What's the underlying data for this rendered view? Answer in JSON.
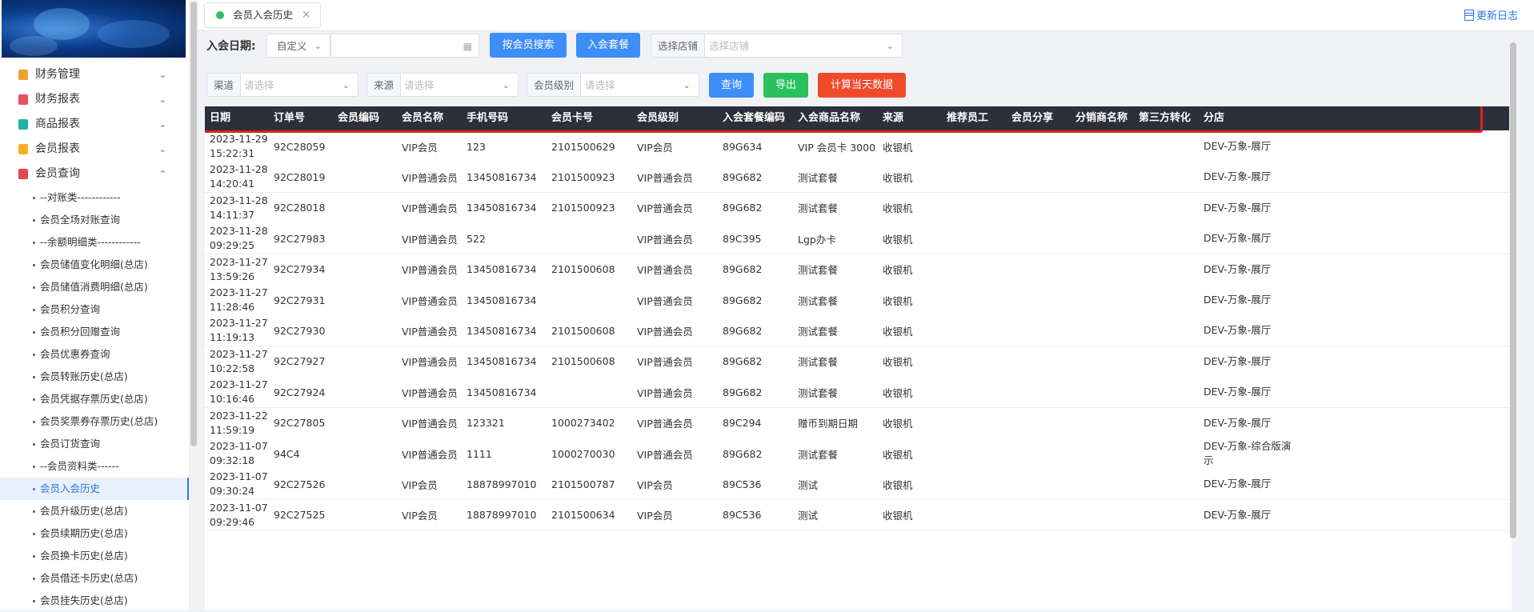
{
  "tab": {
    "label": "会员入会历史",
    "close": "×"
  },
  "update_log": "更新日志",
  "sidebar": {
    "menu": [
      {
        "label": "财务管理",
        "color": "#f0a030",
        "chevron": "⌄"
      },
      {
        "label": "财务报表",
        "color": "#e8505b",
        "chevron": "⌄"
      },
      {
        "label": "商品报表",
        "color": "#1fb0a8",
        "chevron": "⌄"
      },
      {
        "label": "会员报表",
        "color": "#f5b025",
        "chevron": "⌄"
      },
      {
        "label": "会员查询",
        "color": "#e24848",
        "chevron": "⌃"
      }
    ],
    "sub_items": [
      "--对账类------------",
      "会员全场对账查询",
      "--余额明细类------------",
      "会员储值变化明细(总店)",
      "会员储值消费明细(总店)",
      "会员积分查询",
      "会员积分回赠查询",
      "会员优惠券查询",
      "会员转账历史(总店)",
      "会员凭据存票历史(总店)",
      "会员奖票券存票历史(总店)",
      "会员订货查询",
      "--会员资料类------",
      "会员入会历史",
      "会员升级历史(总店)",
      "会员续期历史(总店)",
      "会员换卡历史(总店)",
      "会员借还卡历史(总店)",
      "会员挂失历史(总店)"
    ],
    "active_index": 13
  },
  "filters": {
    "join_date_label": "入会日期:",
    "date_mode": "自定义",
    "search_by_member_btn": "按会员搜索",
    "join_package_btn": "入会套餐",
    "store_prefix": "选择店铺",
    "store_placeholder": "选择店铺",
    "channel_prefix": "渠道",
    "channel_placeholder": "请选择",
    "source_prefix": "来源",
    "source_placeholder": "请选择",
    "level_prefix": "会员级别",
    "level_placeholder": "请选择",
    "query_btn": "查询",
    "export_btn": "导出",
    "calc_today_btn": "计算当天数据"
  },
  "table": {
    "columns": [
      "日期",
      "订单号",
      "会员编码",
      "会员名称",
      "手机号码",
      "会员卡号",
      "会员级别",
      "入会套餐编码",
      "入会商品名称",
      "来源",
      "推荐员工",
      "会员分享",
      "分销商名称",
      "第三方转化",
      "分店"
    ],
    "rows": [
      [
        "2023-11-29 15:22:31",
        "92C28059",
        "",
        "VIP会员",
        "123",
        "2101500629",
        "VIP会员",
        "89G634",
        "VIP 会员卡 3000",
        "收银机",
        "",
        "",
        "",
        "",
        "DEV-万象-展厅"
      ],
      [
        "2023-11-28 14:20:41",
        "92C28019",
        "",
        "VIP普通会员",
        "13450816734",
        "2101500923",
        "VIP普通会员",
        "89G682",
        "测试套餐",
        "收银机",
        "",
        "",
        "",
        "",
        "DEV-万象-展厅"
      ],
      [
        "2023-11-28 14:11:37",
        "92C28018",
        "",
        "VIP普通会员",
        "13450816734",
        "2101500923",
        "VIP普通会员",
        "89G682",
        "测试套餐",
        "收银机",
        "",
        "",
        "",
        "",
        "DEV-万象-展厅"
      ],
      [
        "2023-11-28 09:29:25",
        "92C27983",
        "",
        "VIP普通会员",
        "522",
        "",
        "VIP普通会员",
        "89C395",
        "Lgp办卡",
        "收银机",
        "",
        "",
        "",
        "",
        "DEV-万象-展厅"
      ],
      [
        "2023-11-27 13:59:26",
        "92C27934",
        "",
        "VIP普通会员",
        "13450816734",
        "2101500608",
        "VIP普通会员",
        "89G682",
        "测试套餐",
        "收银机",
        "",
        "",
        "",
        "",
        "DEV-万象-展厅"
      ],
      [
        "2023-11-27 11:28:46",
        "92C27931",
        "",
        "VIP普通会员",
        "13450816734",
        "",
        "VIP普通会员",
        "89G682",
        "测试套餐",
        "收银机",
        "",
        "",
        "",
        "",
        "DEV-万象-展厅"
      ],
      [
        "2023-11-27 11:19:13",
        "92C27930",
        "",
        "VIP普通会员",
        "13450816734",
        "2101500608",
        "VIP普通会员",
        "89G682",
        "测试套餐",
        "收银机",
        "",
        "",
        "",
        "",
        "DEV-万象-展厅"
      ],
      [
        "2023-11-27 10:22:58",
        "92C27927",
        "",
        "VIP普通会员",
        "13450816734",
        "2101500608",
        "VIP普通会员",
        "89G682",
        "测试套餐",
        "收银机",
        "",
        "",
        "",
        "",
        "DEV-万象-展厅"
      ],
      [
        "2023-11-27 10:16:46",
        "92C27924",
        "",
        "VIP普通会员",
        "13450816734",
        "",
        "VIP普通会员",
        "89G682",
        "测试套餐",
        "收银机",
        "",
        "",
        "",
        "",
        "DEV-万象-展厅"
      ],
      [
        "2023-11-22 11:59:19",
        "92C27805",
        "",
        "VIP普通会员",
        "123321",
        "1000273402",
        "VIP普通会员",
        "89C294",
        "赠币到期日期",
        "收银机",
        "",
        "",
        "",
        "",
        "DEV-万象-展厅"
      ],
      [
        "2023-11-07 09:32:18",
        "94C4",
        "",
        "VIP普通会员",
        "1111",
        "1000270030",
        "VIP普通会员",
        "89G682",
        "测试套餐",
        "收银机",
        "",
        "",
        "",
        "",
        "DEV-万象-综合版演示"
      ],
      [
        "2023-11-07 09:30:24",
        "92C27526",
        "",
        "VIP会员",
        "18878997010",
        "2101500787",
        "VIP会员",
        "89C536",
        "测试",
        "收银机",
        "",
        "",
        "",
        "",
        "DEV-万象-展厅"
      ],
      [
        "2023-11-07 09:29:46",
        "92C27525",
        "",
        "VIP会员",
        "18878997010",
        "2101500634",
        "VIP会员",
        "89C536",
        "测试",
        "收银机",
        "",
        "",
        "",
        "",
        "DEV-万象-展厅"
      ]
    ]
  }
}
